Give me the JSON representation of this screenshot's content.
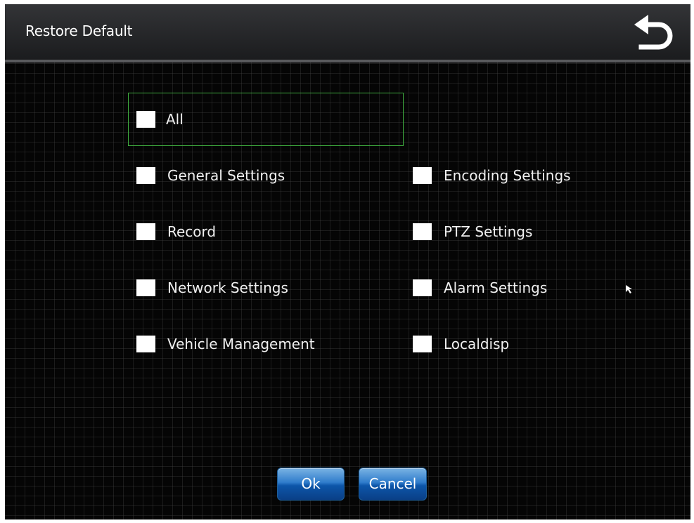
{
  "header": {
    "title": "Restore Default",
    "back_icon": "return-arrow-icon"
  },
  "options": {
    "all": {
      "label": "All",
      "checked": false
    },
    "general_settings": {
      "label": "General Settings",
      "checked": false
    },
    "encoding_settings": {
      "label": "Encoding Settings",
      "checked": false
    },
    "record": {
      "label": "Record",
      "checked": false
    },
    "ptz_settings": {
      "label": "PTZ Settings",
      "checked": false
    },
    "network_settings": {
      "label": "Network Settings",
      "checked": false
    },
    "alarm_settings": {
      "label": "Alarm Settings",
      "checked": false
    },
    "vehicle_management": {
      "label": "Vehicle Management",
      "checked": false
    },
    "localdisp": {
      "label": "Localdisp",
      "checked": false
    }
  },
  "buttons": {
    "ok_label": "Ok",
    "cancel_label": "Cancel"
  },
  "colors": {
    "background": "#050505",
    "focus_border": "#3fae3f",
    "button_blue": "#2f7ccb",
    "checkbox": "#ffffff"
  }
}
